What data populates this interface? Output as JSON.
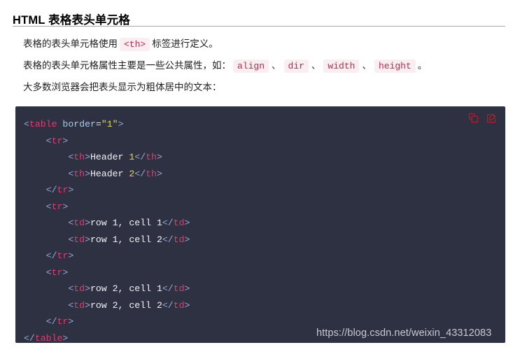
{
  "page": {
    "title": "HTML 表格表头单元格",
    "background_color": "#ffffff"
  },
  "article": {
    "paragraphs": [
      {
        "id": "p1",
        "parts": [
          {
            "type": "text",
            "value": "表格的表头单元格使用"
          },
          {
            "type": "code",
            "value": "<th>"
          },
          {
            "type": "text",
            "value": "标签进行定义。"
          }
        ]
      },
      {
        "id": "p2",
        "parts": [
          {
            "type": "text",
            "value": "表格的表头单元格属性主要是一些公共属性，如："
          },
          {
            "type": "code",
            "value": "align"
          },
          {
            "type": "sep",
            "value": "、"
          },
          {
            "type": "code",
            "value": "dir"
          },
          {
            "type": "sep",
            "value": "、"
          },
          {
            "type": "code",
            "value": "width"
          },
          {
            "type": "sep",
            "value": "、"
          },
          {
            "type": "code",
            "value": "height"
          },
          {
            "type": "text",
            "value": "。"
          }
        ]
      },
      {
        "id": "p3",
        "parts": [
          {
            "type": "text",
            "value": "大多数浏览器会把表头显示为粗体居中的文本："
          }
        ]
      }
    ],
    "inline_code_color": "#c7254e",
    "inline_code_background": "#fbeef1"
  },
  "code_block": {
    "language": "html",
    "background_color": "#2d3142",
    "actions": [
      {
        "name": "copy-icon",
        "label": "复制",
        "color": "#b3202a"
      },
      {
        "name": "edit-icon",
        "label": "编辑",
        "color": "#b3202a"
      }
    ],
    "token_colors": {
      "punctuation": "#9aa6d1",
      "tag": "#e63a6e",
      "attribute": "#a8cbe8",
      "value": "#e8d84e",
      "text": "#f2f2f6"
    },
    "lines": [
      {
        "indent": 0,
        "tokens": [
          {
            "c": "punc",
            "v": "<"
          },
          {
            "c": "tag",
            "v": "table"
          },
          {
            "c": "text",
            "v": " "
          },
          {
            "c": "attr",
            "v": "border"
          },
          {
            "c": "eq",
            "v": "="
          },
          {
            "c": "val",
            "v": "\"1\""
          },
          {
            "c": "punc",
            "v": ">"
          }
        ]
      },
      {
        "indent": 1,
        "tokens": [
          {
            "c": "punc",
            "v": "<"
          },
          {
            "c": "tag",
            "v": "tr"
          },
          {
            "c": "punc",
            "v": ">"
          }
        ]
      },
      {
        "indent": 2,
        "tokens": [
          {
            "c": "punc",
            "v": "<"
          },
          {
            "c": "tag",
            "v": "th"
          },
          {
            "c": "punc",
            "v": ">"
          },
          {
            "c": "text",
            "v": "Header "
          },
          {
            "c": "num",
            "v": "1"
          },
          {
            "c": "punc",
            "v": "</"
          },
          {
            "c": "tag",
            "v": "th"
          },
          {
            "c": "punc",
            "v": ">"
          }
        ]
      },
      {
        "indent": 2,
        "tokens": [
          {
            "c": "punc",
            "v": "<"
          },
          {
            "c": "tag",
            "v": "th"
          },
          {
            "c": "punc",
            "v": ">"
          },
          {
            "c": "text",
            "v": "Header "
          },
          {
            "c": "num",
            "v": "2"
          },
          {
            "c": "punc",
            "v": "</"
          },
          {
            "c": "tag",
            "v": "th"
          },
          {
            "c": "punc",
            "v": ">"
          }
        ]
      },
      {
        "indent": 1,
        "tokens": [
          {
            "c": "punc",
            "v": "</"
          },
          {
            "c": "tag",
            "v": "tr"
          },
          {
            "c": "punc",
            "v": ">"
          }
        ]
      },
      {
        "indent": 1,
        "tokens": [
          {
            "c": "punc",
            "v": "<"
          },
          {
            "c": "tag",
            "v": "tr"
          },
          {
            "c": "punc",
            "v": ">"
          }
        ]
      },
      {
        "indent": 2,
        "tokens": [
          {
            "c": "punc",
            "v": "<"
          },
          {
            "c": "tag",
            "v": "td"
          },
          {
            "c": "punc",
            "v": ">"
          },
          {
            "c": "text",
            "v": "row 1, cell 1"
          },
          {
            "c": "punc",
            "v": "</"
          },
          {
            "c": "tag",
            "v": "td"
          },
          {
            "c": "punc",
            "v": ">"
          }
        ]
      },
      {
        "indent": 2,
        "tokens": [
          {
            "c": "punc",
            "v": "<"
          },
          {
            "c": "tag",
            "v": "td"
          },
          {
            "c": "punc",
            "v": ">"
          },
          {
            "c": "text",
            "v": "row 1, cell 2"
          },
          {
            "c": "punc",
            "v": "</"
          },
          {
            "c": "tag",
            "v": "td"
          },
          {
            "c": "punc",
            "v": ">"
          }
        ]
      },
      {
        "indent": 1,
        "tokens": [
          {
            "c": "punc",
            "v": "</"
          },
          {
            "c": "tag",
            "v": "tr"
          },
          {
            "c": "punc",
            "v": ">"
          }
        ]
      },
      {
        "indent": 1,
        "tokens": [
          {
            "c": "punc",
            "v": "<"
          },
          {
            "c": "tag",
            "v": "tr"
          },
          {
            "c": "punc",
            "v": ">"
          }
        ]
      },
      {
        "indent": 2,
        "tokens": [
          {
            "c": "punc",
            "v": "<"
          },
          {
            "c": "tag",
            "v": "td"
          },
          {
            "c": "punc",
            "v": ">"
          },
          {
            "c": "text",
            "v": "row 2, cell 1"
          },
          {
            "c": "punc",
            "v": "</"
          },
          {
            "c": "tag",
            "v": "td"
          },
          {
            "c": "punc",
            "v": ">"
          }
        ]
      },
      {
        "indent": 2,
        "tokens": [
          {
            "c": "punc",
            "v": "<"
          },
          {
            "c": "tag",
            "v": "td"
          },
          {
            "c": "punc",
            "v": ">"
          },
          {
            "c": "text",
            "v": "row 2, cell 2"
          },
          {
            "c": "punc",
            "v": "</"
          },
          {
            "c": "tag",
            "v": "td"
          },
          {
            "c": "punc",
            "v": ">"
          }
        ]
      },
      {
        "indent": 1,
        "tokens": [
          {
            "c": "punc",
            "v": "</"
          },
          {
            "c": "tag",
            "v": "tr"
          },
          {
            "c": "punc",
            "v": ">"
          }
        ]
      },
      {
        "indent": 0,
        "tokens": [
          {
            "c": "punc",
            "v": "</"
          },
          {
            "c": "tag",
            "v": "table"
          },
          {
            "c": "punc",
            "v": ">"
          }
        ]
      }
    ]
  },
  "watermark": {
    "text": "https://blog.csdn.net/weixin_43312083",
    "color": "#c7c9d4"
  }
}
